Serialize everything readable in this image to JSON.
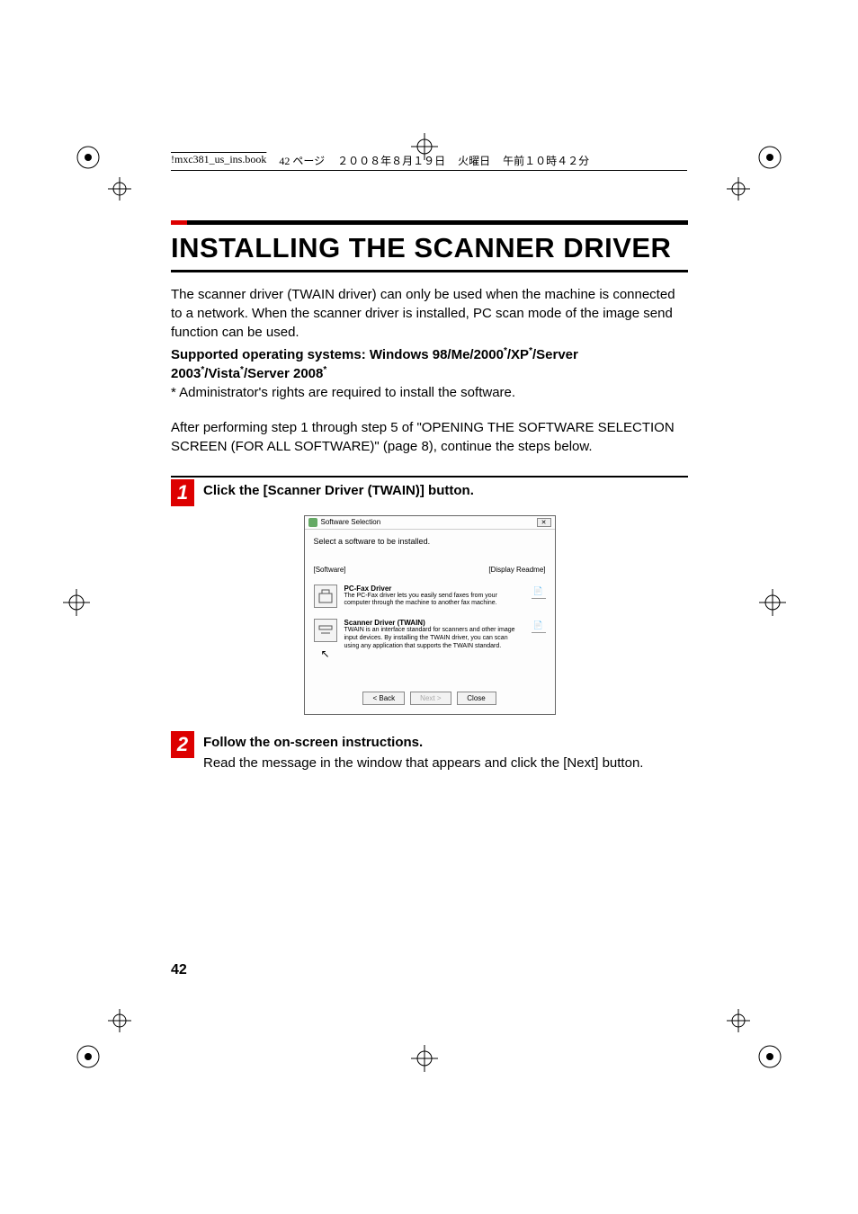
{
  "header": {
    "filename": "!mxc381_us_ins.book",
    "page_info": "42 ページ",
    "date": "２００８年８月１９日",
    "day": "火曜日",
    "time": "午前１０時４２分"
  },
  "title": "INSTALLING THE SCANNER DRIVER",
  "intro": "The scanner driver (TWAIN driver) can only be used when the machine is connected to a network. When the scanner driver is installed, PC scan mode of the image send function can be used.",
  "supported_prefix": "Supported operating systems: Windows 98/Me/2000",
  "supported_mid1": "/XP",
  "supported_mid2": "/Server 2003",
  "supported_mid3": "/Vista",
  "supported_mid4": "/Server 2008",
  "footnote": "* Administrator's rights are required to install the software.",
  "continue_text": "After performing step 1 through step 5 of \"OPENING THE SOFTWARE SELECTION SCREEN (FOR ALL SOFTWARE)\" (page 8), continue the steps below.",
  "steps": [
    {
      "num": "1",
      "title": "Click the [Scanner Driver (TWAIN)] button."
    },
    {
      "num": "2",
      "title": "Follow the on-screen instructions.",
      "text": "Read the message in the window that appears and click the [Next] button."
    }
  ],
  "screenshot": {
    "window_title": "Software Selection",
    "prompt": "Select a software to be installed.",
    "label_software": "[Software]",
    "label_readme": "[Display Readme]",
    "items": [
      {
        "title": "PC-Fax Driver",
        "desc": "The PC-Fax driver lets you easily send faxes from your computer through the machine to another fax machine."
      },
      {
        "title": "Scanner Driver (TWAIN)",
        "desc": "TWAIN is an interface standard for scanners and other image input devices. By installing the TWAIN driver, you can scan using any application that supports the TWAIN standard."
      }
    ],
    "buttons": {
      "back": "< Back",
      "next": "Next >",
      "close": "Close"
    }
  },
  "page_number": "42"
}
